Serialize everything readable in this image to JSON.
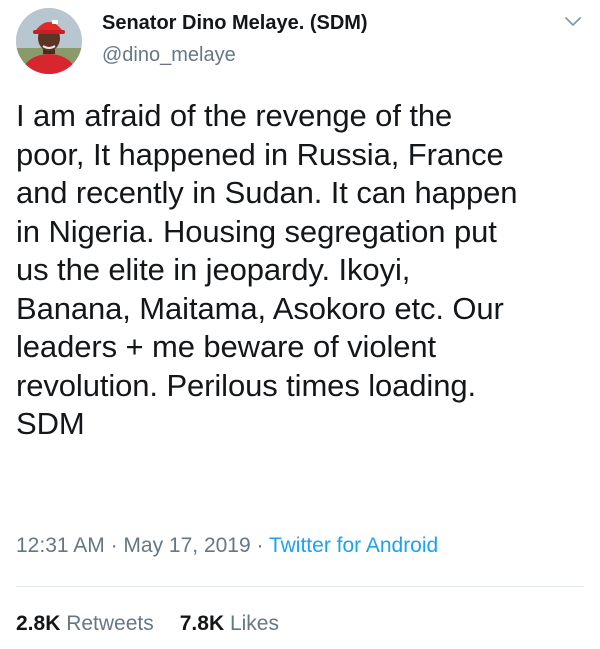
{
  "author": {
    "name": "Senator Dino Melaye. (SDM)",
    "handle": "@dino_melaye",
    "avatar_icon": "profile-photo-icon"
  },
  "menu": {
    "icon": "chevron-down-icon"
  },
  "tweet": {
    "lines": [
      "I am afraid of the revenge of the",
      "poor, It happened in Russia, France",
      "and recently in Sudan. It can happen",
      "in Nigeria. Housing segregation put",
      "us the elite in jeopardy. Ikoyi,",
      "Banana, Maitama, Asokoro etc. Our",
      "leaders + me beware of violent",
      "revolution. Perilous times loading.",
      "SDM"
    ]
  },
  "meta": {
    "time": "12:31 AM",
    "separator": " · ",
    "date": "May 17, 2019",
    "source": "Twitter for Android"
  },
  "stats": {
    "retweets_count": "2.8K",
    "retweets_label": "Retweets",
    "likes_count": "7.8K",
    "likes_label": "Likes"
  },
  "colors": {
    "text": "#14171a",
    "secondary": "#657786",
    "link": "#1da1f2",
    "divider": "#e1e8ed"
  }
}
